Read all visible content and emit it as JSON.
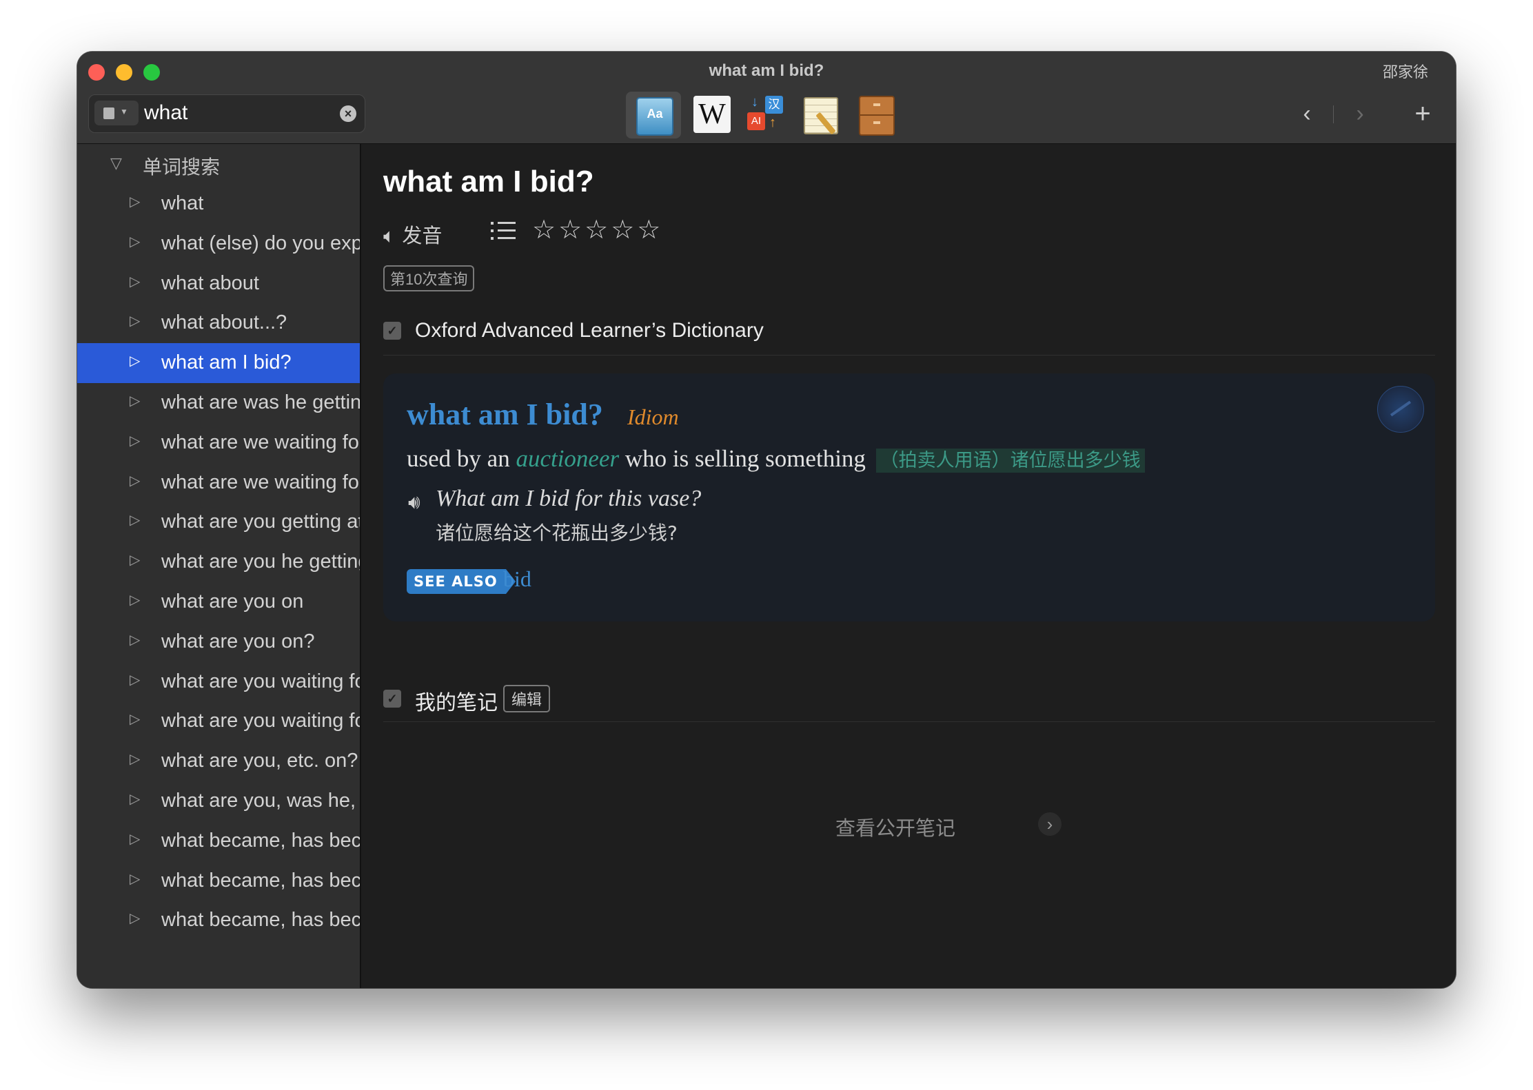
{
  "window": {
    "title": "what am I bid?",
    "user": "邵家徐"
  },
  "search": {
    "value": "what",
    "placeholder": ""
  },
  "toolbar": {
    "tools": [
      {
        "name": "dictionary",
        "icon": "dictionary-icon",
        "glyph": "Aa",
        "active": true
      },
      {
        "name": "wikipedia",
        "icon": "wikipedia-icon",
        "glyph": "W",
        "active": false
      },
      {
        "name": "translate",
        "icon": "translate-icon",
        "glyph_a": "AI",
        "glyph_b": "汉",
        "active": false
      },
      {
        "name": "notes",
        "icon": "notepad-icon",
        "active": false
      },
      {
        "name": "archive",
        "icon": "cabinet-icon",
        "active": false
      }
    ],
    "back": "‹",
    "forward": "›",
    "add": "+"
  },
  "sidebar": {
    "header": "单词搜索",
    "items": [
      {
        "label": "what",
        "selected": false
      },
      {
        "label": "what (else) do you expect?",
        "selected": false
      },
      {
        "label": "what about",
        "selected": false
      },
      {
        "label": "what about...?",
        "selected": false
      },
      {
        "label": "what am I bid?",
        "selected": true
      },
      {
        "label": "what are was he getting at?",
        "selected": false
      },
      {
        "label": "what are we waiting for?",
        "selected": false
      },
      {
        "label": "what are we waiting for?",
        "selected": false
      },
      {
        "label": "what are you getting at?",
        "selected": false
      },
      {
        "label": "what are you he getting at?",
        "selected": false
      },
      {
        "label": "what are you on",
        "selected": false
      },
      {
        "label": "what are you on?",
        "selected": false
      },
      {
        "label": "what are you waiting for?",
        "selected": false
      },
      {
        "label": "what are you waiting for?",
        "selected": false
      },
      {
        "label": "what are you, etc. on?",
        "selected": false
      },
      {
        "label": "what are you, was he, etc. getting at?",
        "selected": false
      },
      {
        "label": "what became, has become, will become of...?",
        "selected": false
      },
      {
        "label": "what became, has become, will become of...?",
        "selected": false
      },
      {
        "label": "what became, has become, will become of...?",
        "selected": false
      }
    ]
  },
  "entry": {
    "title": "what am I bid?",
    "pronounce_label": "发音",
    "rating_stars": "☆☆☆☆☆",
    "query_count_badge": "第10次查询",
    "dictionary_name": "Oxford Advanced Learner’s Dictionary",
    "card": {
      "headword": "what am I bid?",
      "pos": "Idiom",
      "def_prefix": "used by an",
      "def_keyword": "auctioneer",
      "def_suffix": "who is selling something",
      "def_cn": "（拍卖人用语）诸位愿出多少钱",
      "example": "What am I bid for this vase?",
      "example_cn": "诸位愿给这个花瓶出多少钱?",
      "see_also_label": "SEE ALSO",
      "see_also_link": "bid"
    },
    "notes_label": "我的笔记",
    "notes_edit": "编辑",
    "public_notes": "查看公开笔记"
  },
  "colors": {
    "accent_blue": "#3d8cd2",
    "selection": "#2a5ad8",
    "pos_orange": "#e08a2c",
    "keyword_green": "#35a08c"
  }
}
